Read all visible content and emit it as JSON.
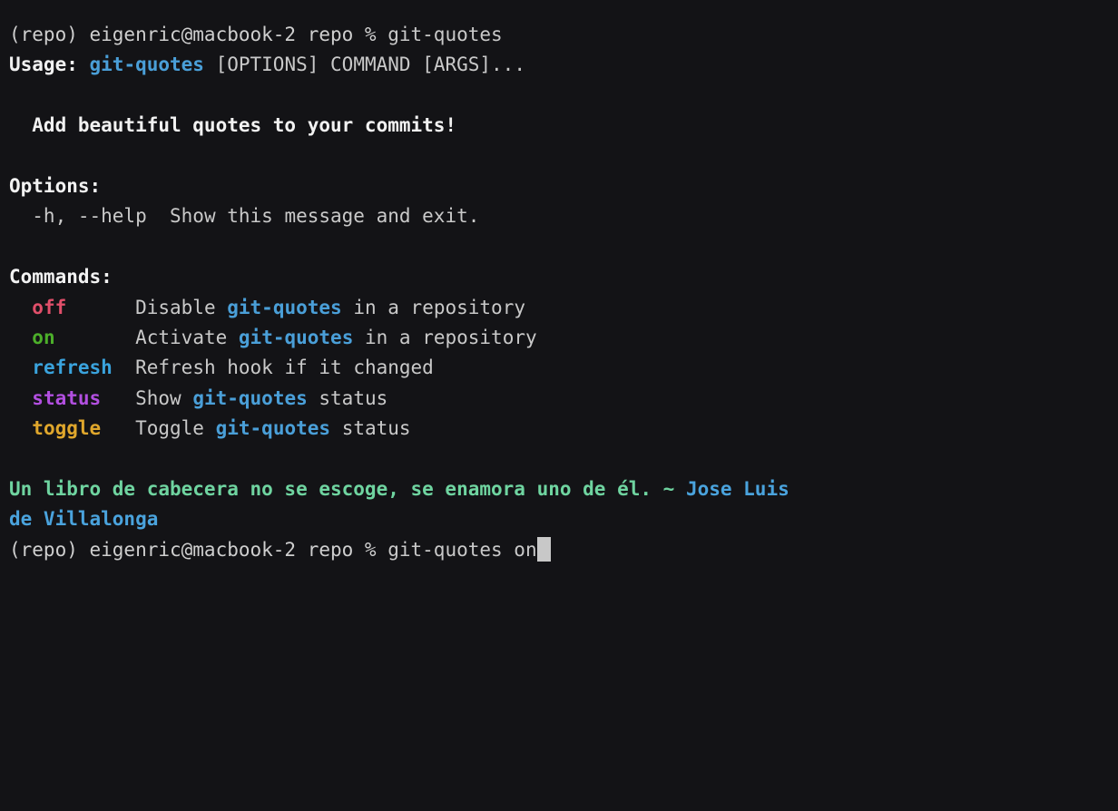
{
  "terminal": {
    "background_color": "#131316",
    "foreground_color": "#d0d0d0",
    "cursor_color": "#c8c8c8",
    "font_size_px": 21,
    "prompt_prefix": "(repo) eigenric@macbook-2 repo % "
  },
  "palette": {
    "white": "#f2f2f2",
    "gray": "#c9c9c9",
    "blue": "#4a9fd8",
    "red": "#e14f6a",
    "green": "#4caf2a",
    "cyan": "#3aa3dd",
    "purple": "#b24fe0",
    "orange": "#e0a72c",
    "mint": "#6fd4a0",
    "author_blue": "#4aa3dd"
  },
  "session": {
    "first_command_line": {
      "prompt": "(repo) eigenric@macbook-2 repo % ",
      "command": "git-quotes"
    },
    "usage": {
      "label": "Usage:",
      "program": "git-quotes",
      "args": " [OPTIONS] COMMAND [ARGS]..."
    },
    "description": "  Add beautiful quotes to your commits!",
    "options_header": "Options:",
    "options": [
      {
        "flags": "  -h, --help",
        "gap": "  ",
        "description": "Show this message and exit."
      }
    ],
    "commands_header": "Commands:",
    "commands": [
      {
        "name": "off",
        "name_color": "red",
        "indent": "  ",
        "pad": "      ",
        "desc_before": "Disable ",
        "desc_program": "git-quotes",
        "desc_after": " in a repository"
      },
      {
        "name": "on",
        "name_color": "green",
        "indent": "  ",
        "pad": "       ",
        "desc_before": "Activate ",
        "desc_program": "git-quotes",
        "desc_after": " in a repository"
      },
      {
        "name": "refresh",
        "name_color": "cyan",
        "indent": "  ",
        "pad": "  ",
        "desc_before": "Refresh hook if it changed",
        "desc_program": "",
        "desc_after": ""
      },
      {
        "name": "status",
        "name_color": "purple",
        "indent": "  ",
        "pad": "   ",
        "desc_before": "Show ",
        "desc_program": "git-quotes",
        "desc_after": " status"
      },
      {
        "name": "toggle",
        "name_color": "orange",
        "indent": "  ",
        "pad": "   ",
        "desc_before": "Toggle ",
        "desc_program": "git-quotes",
        "desc_after": " status"
      }
    ],
    "quote": {
      "text_line1": "Un libro de cabecera no se escoge, se enamora uno de él. ~ ",
      "author_line1": "Jose Luis",
      "author_line2": "de Villalonga"
    },
    "last_command_line": {
      "prompt": "(repo) eigenric@macbook-2 repo % ",
      "command": "git-quotes on"
    }
  }
}
